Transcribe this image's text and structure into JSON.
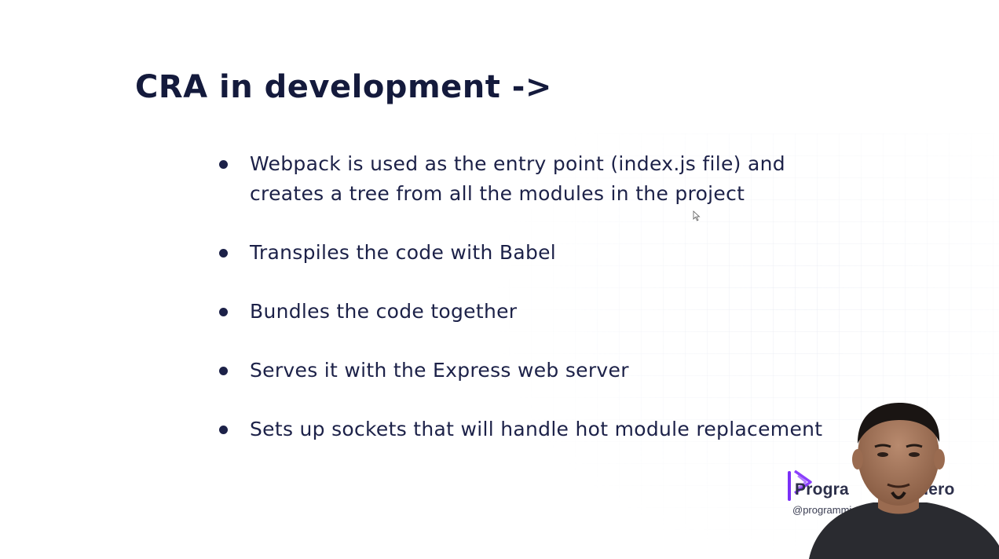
{
  "slide": {
    "title": "CRA in development ->",
    "bullets": [
      {
        "lines": [
          "Webpack is used as the  entry point (index.js file) and",
          "creates a tree from all the modules in the project"
        ]
      },
      {
        "lines": [
          "Transpiles the code with Babel"
        ]
      },
      {
        "lines": [
          "Bundles the code together"
        ]
      },
      {
        "lines": [
          "Serves it with the Express web server"
        ]
      },
      {
        "lines": [
          "Sets up sockets that will handle hot module replacement"
        ]
      }
    ]
  },
  "overlay": {
    "brand_name_visible": "Progra",
    "brand_name_suffix": "Hero",
    "handle_visible": "@programmi"
  },
  "colors": {
    "text": "#1c2148",
    "brand_accent": "#7b2ff7"
  }
}
